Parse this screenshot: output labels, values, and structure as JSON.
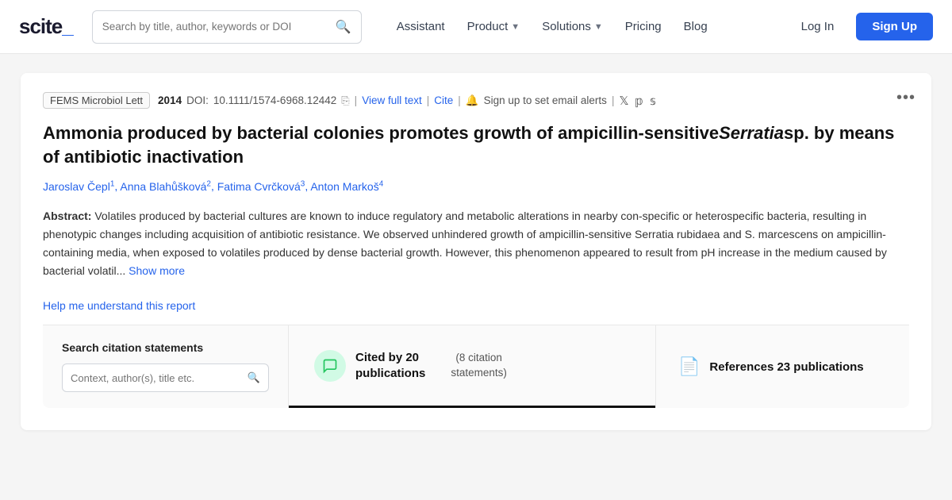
{
  "navbar": {
    "logo_text": "scite_",
    "search_placeholder": "Search by title, author, keywords or DOI",
    "assistant_label": "Assistant",
    "product_label": "Product",
    "solutions_label": "Solutions",
    "pricing_label": "Pricing",
    "blog_label": "Blog",
    "login_label": "Log In",
    "signup_label": "Sign Up"
  },
  "article": {
    "journal": "FEMS Microbiol Lett",
    "year": "2014",
    "doi_label": "DOI:",
    "doi_value": "10.1111/1574-6968.12442",
    "view_full_text": "View full text",
    "cite_label": "Cite",
    "alert_label": "Sign up to set email alerts",
    "title": "Ammonia produced by bacterial colonies promotes growth of ampicillin-sensitive",
    "title_italic": "Serratia",
    "title_suffix": "sp. by means of antibiotic inactivation",
    "authors": [
      {
        "name": "Jaroslav Čepl",
        "sup": "1"
      },
      {
        "name": "Anna Blahůšková",
        "sup": "2"
      },
      {
        "name": "Fatima Cvrčková",
        "sup": "3"
      },
      {
        "name": "Anton Markoš",
        "sup": "4"
      }
    ],
    "abstract_label": "Abstract:",
    "abstract_text": "Volatiles produced by bacterial cultures are known to induce regulatory and metabolic alterations in nearby con-specific or heterospecific bacteria, resulting in phenotypic changes including acquisition of antibiotic resistance. We observed unhindered growth of ampicillin-sensitive Serratia rubidaea and S. marcescens on ampicillin-containing media, when exposed to volatiles produced by dense bacterial growth. However, this phenomenon appeared to result from pH increase in the medium caused by bacterial volatil...",
    "show_more_label": "Show more",
    "help_link_label": "Help me understand this report"
  },
  "bottom": {
    "search_label": "Search citation statements",
    "search_placeholder": "Context, author(s), title etc.",
    "cited_by_count": "Cited by 20",
    "cited_by_suffix": "publications",
    "citation_stmts": "(8 citation",
    "citation_stmts2": "statements)",
    "references_label": "References 23 publications"
  }
}
